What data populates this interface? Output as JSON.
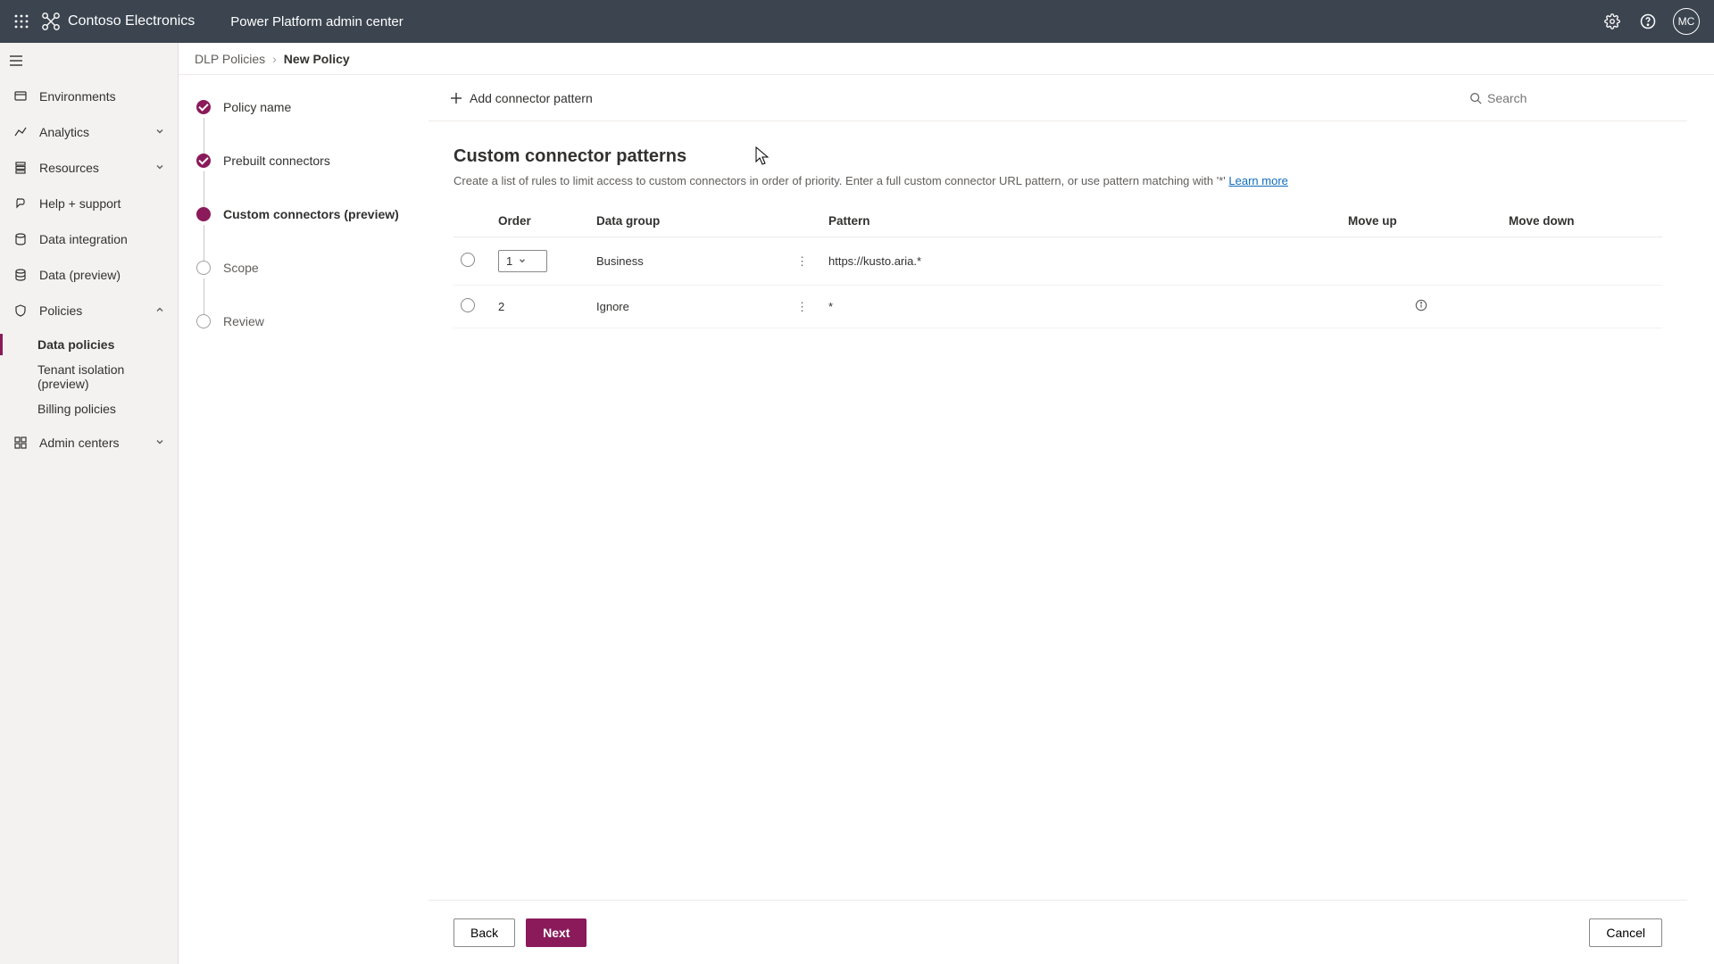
{
  "header": {
    "org": "Contoso Electronics",
    "app_title": "Power Platform admin center",
    "avatar_initials": "MC"
  },
  "leftnav": {
    "items": {
      "environments": "Environments",
      "analytics": "Analytics",
      "resources": "Resources",
      "help": "Help + support",
      "data_integration": "Data integration",
      "data_preview": "Data (preview)",
      "policies": "Policies",
      "admin_centers": "Admin centers"
    },
    "policies_sub": {
      "data_policies": "Data policies",
      "tenant_isolation": "Tenant isolation (preview)",
      "billing_policies": "Billing policies"
    }
  },
  "breadcrumb": {
    "parent": "DLP Policies",
    "current": "New Policy"
  },
  "wizard": {
    "steps": {
      "policy_name": "Policy name",
      "prebuilt": "Prebuilt connectors",
      "custom": "Custom connectors (preview)",
      "scope": "Scope",
      "review": "Review"
    }
  },
  "actionbar": {
    "add_label": "Add connector pattern",
    "search_placeholder": "Search"
  },
  "panel": {
    "title": "Custom connector patterns",
    "description_prefix": "Create a list of rules to limit access to custom connectors in order of priority. Enter a full custom connector URL pattern, or use pattern matching with '*' ",
    "learn_more": "Learn more"
  },
  "table": {
    "headers": {
      "order": "Order",
      "data_group": "Data group",
      "pattern": "Pattern",
      "move_up": "Move up",
      "move_down": "Move down"
    },
    "rows": [
      {
        "order": "1",
        "order_editable": true,
        "data_group": "Business",
        "pattern": "https://kusto.aria.*",
        "info": false
      },
      {
        "order": "2",
        "order_editable": false,
        "data_group": "Ignore",
        "pattern": "*",
        "info": true
      }
    ]
  },
  "footer": {
    "back": "Back",
    "next": "Next",
    "cancel": "Cancel"
  }
}
